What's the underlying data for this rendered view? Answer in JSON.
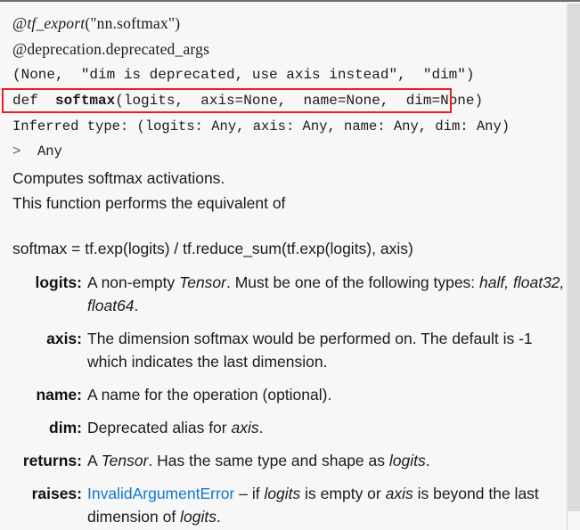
{
  "popup": {
    "kind": "documentation-tooltip",
    "accent_link_color": "#1177d1",
    "annotation_color": "#ed1c24",
    "background_color": "#f7f7f7"
  },
  "signature": {
    "decorator_1_prefix": "@",
    "decorator_1_name": "tf_export",
    "decorator_1_args": "(\"nn.softmax\")",
    "decorator_2": "@deprecation.deprecated_args",
    "decorator_2_args": "(None,  \"dim is deprecated, use axis instead\",  \"dim\")",
    "def_keyword": "def",
    "def_name": "softmax",
    "def_params": "(logits,  axis=None,  name=None,  dim=None)",
    "inferred_type": "Inferred type: (logits: Any, axis: Any, name: Any, dim: Any)",
    "return_chevron": ">",
    "return_type": "Any"
  },
  "description": {
    "line_1": "Computes softmax activations.",
    "line_2": "This function performs the equivalent of",
    "formula": "softmax = tf.exp(logits) / tf.reduce_sum(tf.exp(logits), axis)"
  },
  "parameters": [
    {
      "name": "logits",
      "label": "logits:",
      "desc_part_1": "A non-empty ",
      "desc_italic_1": "Tensor",
      "desc_part_2": ". Must be one of the following types: ",
      "desc_italic_2": "half, float32, float64",
      "desc_part_3": "."
    },
    {
      "name": "axis",
      "label": "axis:",
      "desc_part_1": "The dimension softmax would be performed on. The default is -1 which indicates the last dimension.",
      "desc_italic_1": "",
      "desc_part_2": "",
      "desc_italic_2": "",
      "desc_part_3": ""
    },
    {
      "name": "name",
      "label": "name:",
      "desc_part_1": "A name for the operation (optional).",
      "desc_italic_1": "",
      "desc_part_2": "",
      "desc_italic_2": "",
      "desc_part_3": ""
    },
    {
      "name": "dim",
      "label": "dim:",
      "desc_part_1": "Deprecated alias for ",
      "desc_italic_1": "axis",
      "desc_part_2": ".",
      "desc_italic_2": "",
      "desc_part_3": ""
    },
    {
      "name": "returns",
      "label": "returns:",
      "desc_part_1": "A ",
      "desc_italic_1": "Tensor",
      "desc_part_2": ". Has the same type and shape as ",
      "desc_italic_2": "logits",
      "desc_part_3": "."
    },
    {
      "name": "raises",
      "label": "raises:",
      "link_text": "InvalidArgumentError",
      "desc_part_1": " – if ",
      "desc_italic_1": "logits",
      "desc_part_2": " is empty or ",
      "desc_italic_2": "axis",
      "desc_part_3": " is beyond the last dimension of ",
      "desc_italic_3": "logits",
      "desc_part_4": "."
    }
  ],
  "scrollbar": {
    "orientation": "vertical",
    "position": "top"
  }
}
